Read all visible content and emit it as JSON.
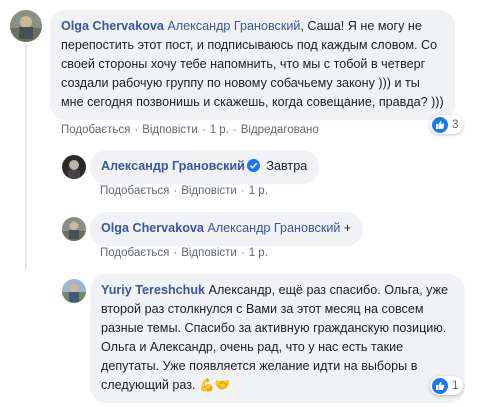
{
  "comments": [
    {
      "author": "Olga Chervakova",
      "mention": "Александр Грановский",
      "text": ", Саша! Я не могу не перепостить этот пост, и подписываюсь под каждым словом. Со своей стороны хочу тебе напомнить, что мы с тобой в четверг создали рабочую группу по новому собачьему закону ))) и ты мне сегодня позвонишь и скажешь, когда совещание, правда? )))",
      "actions": {
        "like": "Подобається",
        "reply": "Відповісти",
        "time": "1 р.",
        "edited": "Відредаговано"
      },
      "reactions": {
        "count": "3"
      }
    },
    {
      "author": "Александр Грановский",
      "text": "Завтра",
      "actions": {
        "like": "Подобається",
        "reply": "Відповісти",
        "time": "1 р."
      }
    },
    {
      "author": "Olga Chervakova",
      "mention": "Александр Грановский",
      "text": " +",
      "actions": {
        "like": "Подобається",
        "reply": "Відповісти",
        "time": "1 р."
      }
    },
    {
      "author": "Yuriy Tereshchuk",
      "text": " Александр, ещё раз спасибо. Ольга, уже второй раз столкнулся с Вами за этот месяц на совсем разные темы. Спасибо за активную гражданскую позицию. Ольга и Александр, очень рад, что у нас есть такие депутаты. Уже появляется желание идти на выборы в следующий раз. 💪🤝",
      "actions": {
        "like": "Подобається",
        "reply": "Відповісти",
        "time": "1 р."
      },
      "reactions": {
        "count": "1"
      }
    }
  ],
  "colors": {
    "bubble": "#f0f2f5",
    "author": "#385898",
    "like": "#1877f2"
  }
}
